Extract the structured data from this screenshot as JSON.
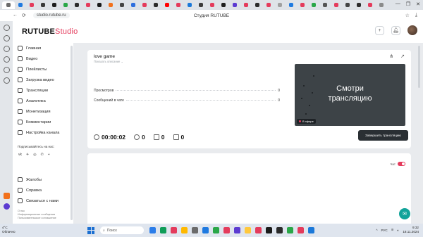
{
  "browser": {
    "url": "studio.rutube.ru",
    "page_title": "Студия RUTUBE",
    "tab_favicon_colors": [
      "#6b6b6b",
      "#1f7ae0",
      "#e43b5c",
      "#3a3a3a",
      "#1e1e1e",
      "#2aa748",
      "#2c2c2c",
      "#e43b5c",
      "#1a1a1a",
      "#f2711c",
      "#444444",
      "#2f6fde",
      "#e43b5c",
      "#2c2c2c",
      "#ff0000",
      "#e43b5c",
      "#1c79d9",
      "#3c3c3c",
      "#e43b5c",
      "#1f1f1f",
      "#5c3bd1",
      "#e43b5c",
      "#2c2c2c",
      "#e43b5c",
      "#a0a0a0",
      "#1f7ae0",
      "#e43b5c",
      "#2aa748",
      "#555555",
      "#e43b5c",
      "#444444",
      "#2c2c2c",
      "#e43b5c",
      "#8b8b8b"
    ]
  },
  "studio": {
    "logo_main": "RUTUBE",
    "logo_suffix": "Studio"
  },
  "sidebar": {
    "items": [
      {
        "label": "Главная",
        "icon": "home-icon"
      },
      {
        "label": "Видео",
        "icon": "video-icon"
      },
      {
        "label": "Плейлисты",
        "icon": "playlist-icon"
      },
      {
        "label": "Загрузка видео",
        "icon": "upload-icon"
      },
      {
        "label": "Трансляции",
        "icon": "broadcast-icon"
      },
      {
        "label": "Аналитика",
        "icon": "analytics-icon"
      },
      {
        "label": "Монетизация",
        "icon": "monetization-icon"
      },
      {
        "label": "Комментарии",
        "icon": "comments-icon"
      },
      {
        "label": "Настройка канала",
        "icon": "settings-icon"
      }
    ],
    "follow_title": "Подписывайтесь на нас:",
    "social": [
      "vk",
      "✈",
      "◎",
      "✆",
      "+"
    ],
    "bottom_items": [
      {
        "label": "Жалобы",
        "icon": "complaint-icon"
      },
      {
        "label": "Справка",
        "icon": "help-icon"
      },
      {
        "label": "Связаться с нами",
        "icon": "contact-icon"
      }
    ],
    "footer_lines": [
      "О нас",
      "Информационные сообщения",
      "Пользовательское соглашение"
    ]
  },
  "stream": {
    "title": "love game",
    "show_more": "Показать описание  ⌄",
    "views_label": "Просмотров",
    "views_value": "0",
    "messages_label": "Сообщений в чате",
    "messages_value": "0",
    "preview_text_line1": "Смотри",
    "preview_text_line2": "трансляцию",
    "live_badge": "В эфире",
    "timer": "00:00:02",
    "viewers": "0",
    "likes": "0",
    "dislikes": "0",
    "end_button": "Завершить трансляцию"
  },
  "chat": {
    "label": "Чат",
    "enabled": true
  },
  "taskbar": {
    "weather_temp": "4°C",
    "weather_desc": "Облачно",
    "search_placeholder": "Поиск",
    "language": "РУС",
    "time": "9:32",
    "date": "18.11.2024"
  },
  "colors": {
    "accent": "#e43b5c",
    "dark_button": "#2a2f33",
    "fab": "#12a39a"
  }
}
